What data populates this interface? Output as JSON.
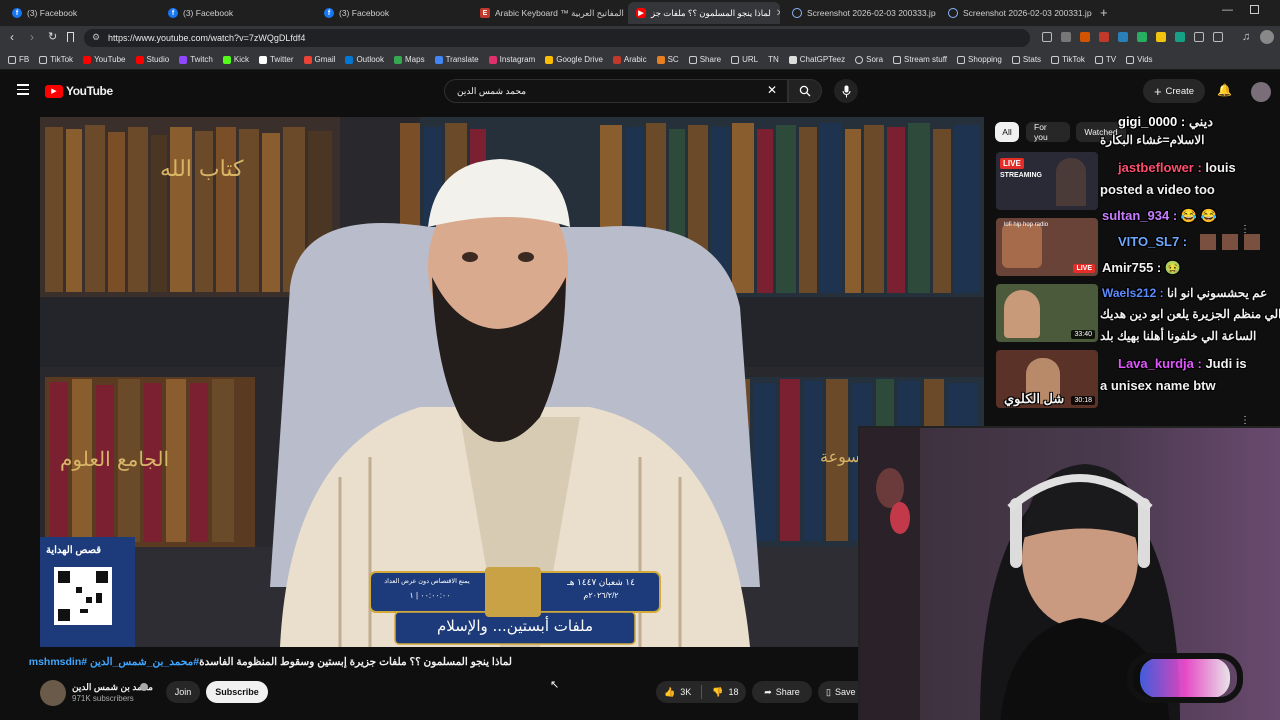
{
  "browser": {
    "tabs": [
      {
        "title": "(3) Facebook",
        "icon": "facebook-icon",
        "color": "#1877f2"
      },
      {
        "title": "(3) Facebook",
        "icon": "facebook-icon",
        "color": "#1877f2"
      },
      {
        "title": "(3) Facebook",
        "icon": "facebook-icon",
        "color": "#1877f2"
      },
      {
        "title": "Arabic Keyboard ™ لوحة المفاتيح العربية",
        "icon": "arabic-keyboard-icon",
        "color": "#c0392b"
      },
      {
        "title": "لماذا ينجو المسلمون ؟؟ ملفات جز",
        "icon": "youtube-icon",
        "color": "#ff0000"
      },
      {
        "title": "Screenshot 2026-02-03 200333.jpg",
        "icon": "globe-icon",
        "color": "#8ab4f8"
      },
      {
        "title": "Screenshot 2026-02-03 200331.jpg",
        "icon": "globe-icon",
        "color": "#8ab4f8"
      }
    ],
    "url": "https://www.youtube.com/watch?v=7zWQgDLfdf4",
    "bookmarks": [
      "FB",
      "TikTok",
      "YouTube",
      "Studio",
      "Twitch",
      "Kick",
      "Twitter",
      "Gmail",
      "Outlook",
      "Maps",
      "Translate",
      "Instagram",
      "Google Drive",
      "Arabic",
      "SC",
      "Share",
      "URL",
      "TN",
      "ChatGPTeez",
      "Sora",
      "Stream stuff",
      "Shopping",
      "Stats",
      "TikTok",
      "TV",
      "Vids"
    ]
  },
  "youtube": {
    "logo": "YouTube",
    "search_value": "محمد شمس الدين",
    "create_label": "Create",
    "chips": [
      "All",
      "For you",
      "Watched"
    ]
  },
  "video": {
    "overlay_caption": "ملفات أبستين... والإسلام",
    "overlay_date_hijri": "١٤ شعبان ١٤٤٧ هـ",
    "overlay_date_greg": "٢٠٢٦/٢/٢م",
    "overlay_notice": "يمنع الاقتصاص دون عرض العداد",
    "overlay_counter": "٠٠:٠٠:٠٠ | ١",
    "qr_label": "قصص الهداية",
    "book_title_1": "كتاب الله",
    "book_title_2": "الجامع العلوم",
    "book_title_3": "موسوعة"
  },
  "below": {
    "title": "لماذا ينجو المسلمون ؟؟ ملفات جزيرة إبستين وسقوط المنظومة الفاسدة",
    "hashtags": "#محمد_بن_شمس_الدين #mshmsdin",
    "channel": "محمد بن شمس الدين",
    "subscribers": "971K subscribers",
    "join": "Join",
    "subscribe": "Subscribe",
    "likes": "3K",
    "dislikes": "18",
    "share": "Share",
    "save": "Save"
  },
  "sidebar_thumbs": [
    {
      "badge": "LIVE",
      "label": "STREAMING"
    },
    {
      "badge": "LIVE",
      "label": "lofi hip hop radio"
    },
    {
      "badge": "33:40",
      "label": ""
    },
    {
      "badge": "30:18",
      "label": ""
    }
  ],
  "chat": [
    {
      "user": "gigi_0000 :",
      "msg": "ديني",
      "color": "#ffffff"
    },
    {
      "user": "",
      "msg": "الاسلام=غشاء البكارة",
      "color": "#ffffff"
    },
    {
      "user": "jastbeflower :",
      "msg": "louis",
      "color": "#ff4d6d"
    },
    {
      "user": "",
      "msg": "posted a video too",
      "color": "#ffffff"
    },
    {
      "user": "sultan_934 :",
      "msg": "😂 😂",
      "color": "#c77dff"
    },
    {
      "user": "VITO_SL7 :",
      "msg": "",
      "color": "#6ea8ff"
    },
    {
      "user": "Amir755 :",
      "msg": "🤢",
      "color": "#ffffff"
    },
    {
      "user": "Waels212 :",
      "msg": "عم يحشسوني انو انا",
      "color": "#5b8cff"
    },
    {
      "user": "",
      "msg": "الي منظم الجزيرة يلعن ابو دين هديك",
      "color": "#ffffff"
    },
    {
      "user": "",
      "msg": "الساعة الي خلفونا أهلنا بهيك بلد",
      "color": "#ffffff"
    },
    {
      "user": "Lava_kurdja :",
      "msg": "Judi is",
      "color": "#e056fd"
    },
    {
      "user": "",
      "msg": "a unisex name btw",
      "color": "#ffffff"
    },
    {
      "user": "",
      "msg": "شل الكلوي",
      "color": "#ffffff"
    }
  ]
}
